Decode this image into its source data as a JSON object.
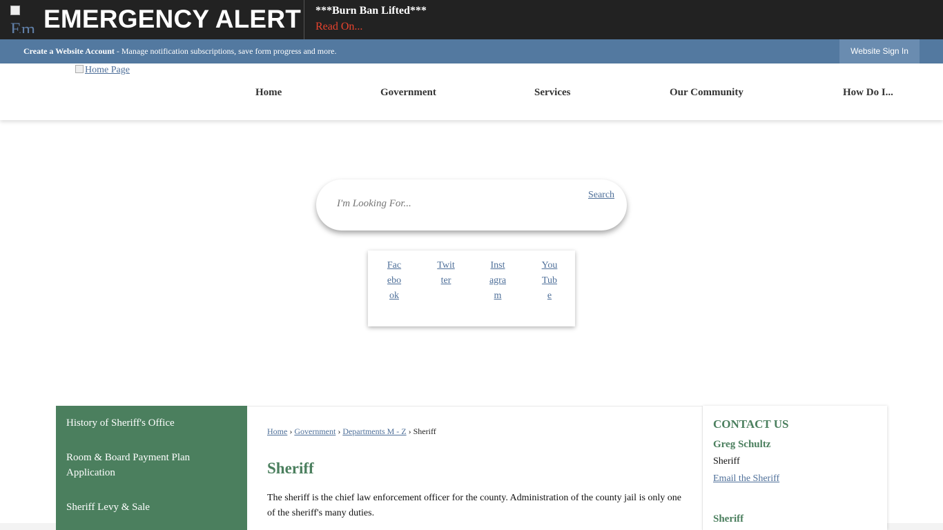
{
  "alert": {
    "icon_alt": "Em",
    "title": "EMERGENCY ALERT",
    "headline": "***Burn Ban Lifted***",
    "read_on": "Read On..."
  },
  "account_bar": {
    "create_label": "Create a Website Account",
    "create_desc": " - Manage notification subscriptions, save form progress and more.",
    "sign_in": "Website Sign In"
  },
  "nav": {
    "logo_alt": "Home Page",
    "items": [
      "Home",
      "Government",
      "Services",
      "Our Community",
      "How Do I..."
    ]
  },
  "search": {
    "placeholder": "I'm Looking For...",
    "button_alt": "Search"
  },
  "social": [
    "Facebook",
    "Twitter",
    "Instagram",
    "YouTube"
  ],
  "sidebar": {
    "items": [
      "History of Sheriff's Office",
      "Room & Board Payment Plan Application",
      "Sheriff Levy & Sale"
    ]
  },
  "breadcrumb": {
    "items": [
      "Home",
      "Government",
      "Departments M - Z"
    ],
    "separator": "›",
    "current": "Sheriff"
  },
  "main": {
    "title": "Sheriff",
    "intro": "The sheriff is the chief law enforcement officer for the county. Administration of the county jail is only one of the sheriff's many duties."
  },
  "contact": {
    "heading": "CONTACT US",
    "name": "Greg Schultz",
    "role": "Sheriff",
    "email_label": "Email the Sheriff",
    "sub_heading": "Sheriff"
  },
  "colors": {
    "alert_bg": "#222222",
    "alert_link": "#e8432e",
    "account_bar": "#5379a0",
    "sidebar_green": "#4b7f5e",
    "link_blue": "#4e6f99"
  }
}
